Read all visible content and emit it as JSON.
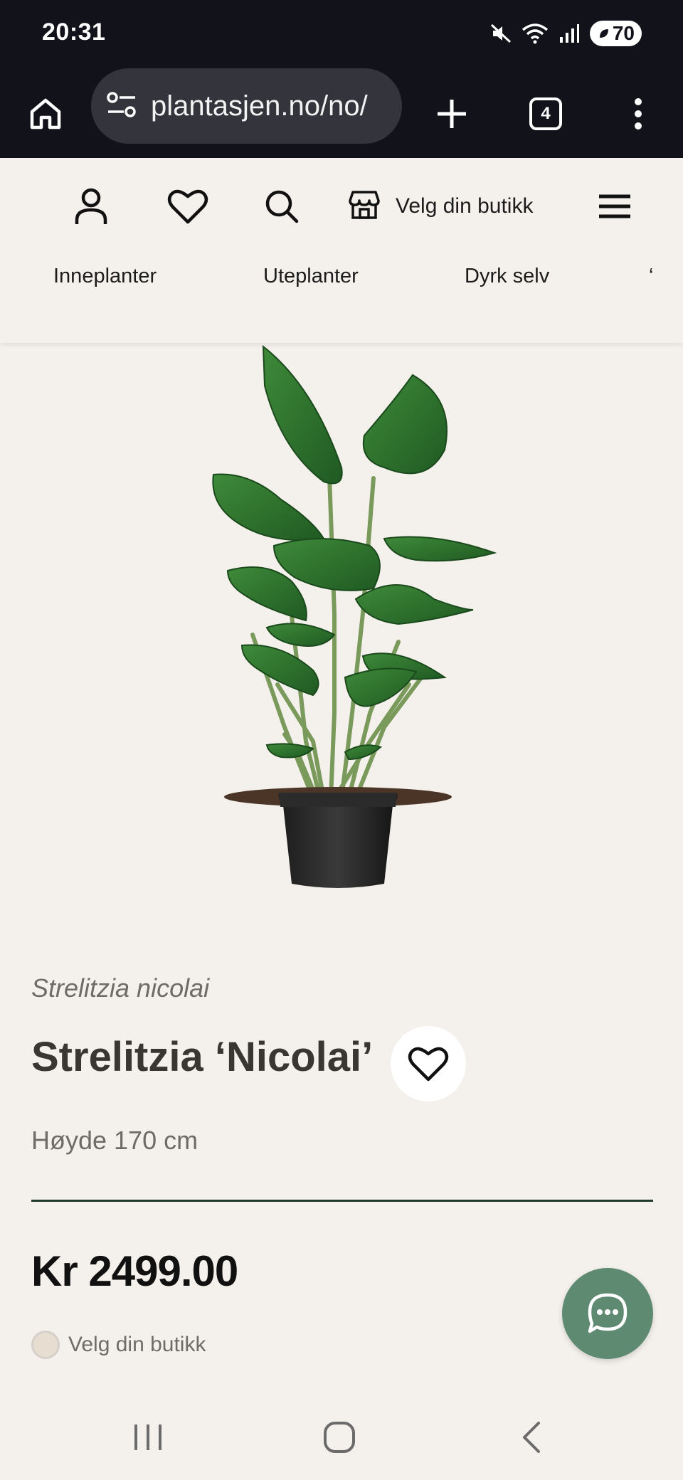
{
  "status_bar": {
    "time": "20:31",
    "battery": "70",
    "icons": [
      "mute-icon",
      "wifi-icon",
      "signal-icon",
      "battery-icon"
    ]
  },
  "browser": {
    "url": "plantasjen.no/no/",
    "tab_count": "4",
    "icons": [
      "home-icon",
      "site-settings-icon",
      "new-tab-icon",
      "tabs-icon",
      "more-icon"
    ]
  },
  "header": {
    "store_label": "Velg din butikk",
    "icons": [
      "account-icon",
      "heart-icon",
      "search-icon",
      "store-icon",
      "menu-icon"
    ],
    "nav_items": [
      "Inneplanter",
      "Uteplanter",
      "Dyrk selv"
    ],
    "nav_more": "‘"
  },
  "product": {
    "latin_name": "Strelitzia nicolai",
    "title": "Strelitzia ‘Nicolai’",
    "height": "Høyde 170 cm",
    "price": "Kr 2499.00",
    "store_status": "Velg din butikk"
  },
  "colors": {
    "background": "#f4f0eb",
    "browser_chrome": "#12131a",
    "accent_green": "#5f8a72",
    "divider": "#1f3a2c"
  },
  "system_nav": {
    "icons": [
      "recent-apps-icon",
      "home-button-icon",
      "back-icon"
    ]
  }
}
